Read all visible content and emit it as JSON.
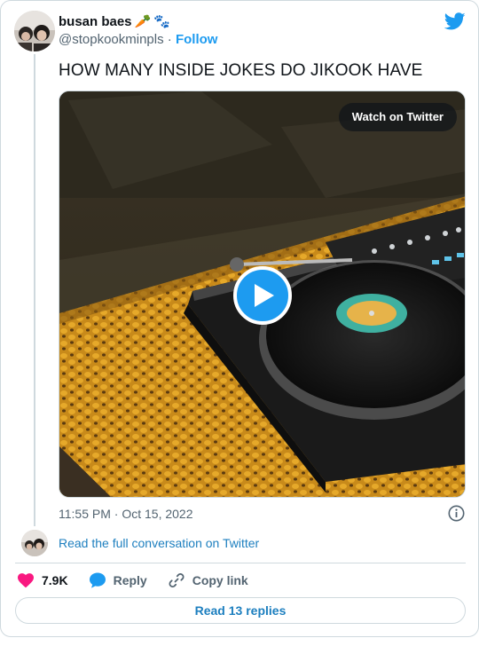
{
  "author": {
    "name": "busan baes",
    "name_emojis": [
      "🥕",
      "🐾"
    ],
    "handle": "@stopkookminpls",
    "separator": "·",
    "follow_label": "Follow"
  },
  "tweet": {
    "text": "HOW MANY INSIDE JOKES DO JIKOOK HAVE",
    "timestamp": "11:55 PM · Oct 15, 2022"
  },
  "media": {
    "watch_label": "Watch on Twitter"
  },
  "conversation": {
    "read_full_label": "Read the full conversation on Twitter"
  },
  "actions": {
    "like_count": "7.9K",
    "reply_label": "Reply",
    "copy_label": "Copy link"
  },
  "replies": {
    "button_label": "Read 13 replies"
  },
  "colors": {
    "brand_blue": "#1d9bf0",
    "like_pink": "#f91880",
    "link_blue": "#1d7fbf",
    "muted_text": "#536471",
    "border": "#cfd9de"
  },
  "icons": [
    "twitter-bird-icon",
    "play-icon",
    "info-icon",
    "heart-icon",
    "reply-bubble-icon",
    "link-icon"
  ]
}
